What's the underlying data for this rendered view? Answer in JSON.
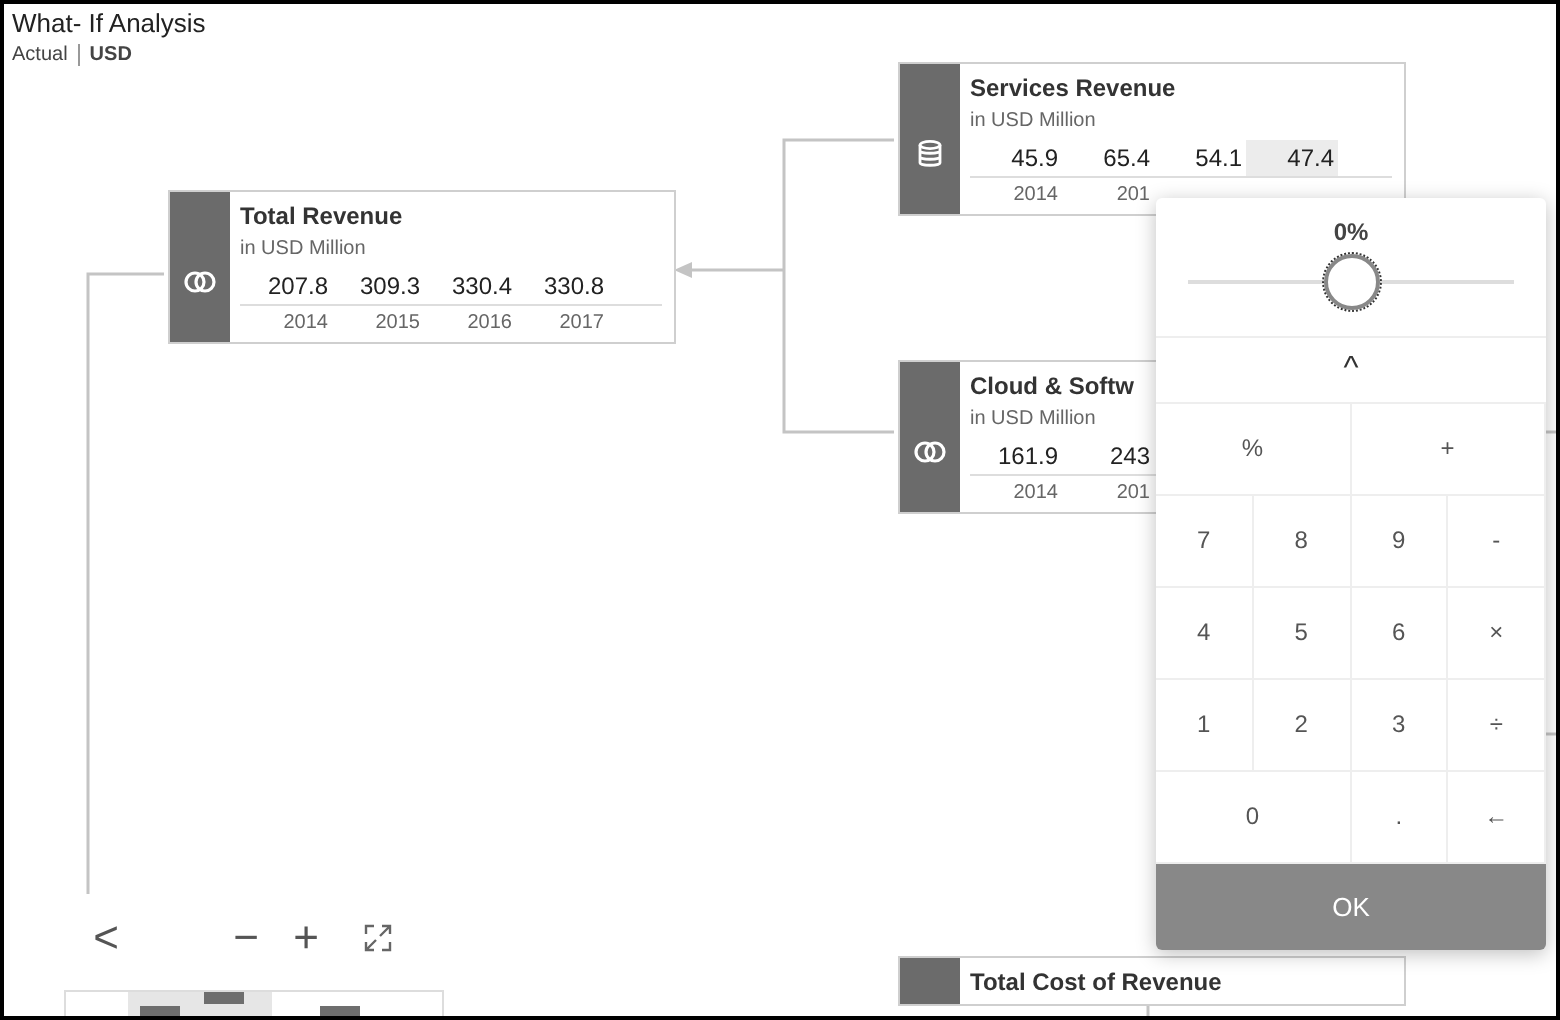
{
  "header": {
    "title": "What- If Analysis",
    "version": "Actual",
    "currency": "USD"
  },
  "nodes": [
    {
      "title": "Total Revenue",
      "unit": "in USD Million",
      "values": [
        {
          "text": "207.8",
          "selected": false
        },
        {
          "text": "309.3",
          "selected": false
        },
        {
          "text": "330.4",
          "selected": false
        },
        {
          "text": "330.8",
          "selected": false
        }
      ],
      "years": [
        "2014",
        "2015",
        "2016",
        "2017"
      ]
    },
    {
      "title": "Services Revenue",
      "unit": "in USD Million",
      "values": [
        {
          "text": "45.9",
          "selected": false
        },
        {
          "text": "65.4",
          "selected": false
        },
        {
          "text": "54.1",
          "selected": false
        },
        {
          "text": "47.4",
          "selected": true
        }
      ],
      "years": [
        "2014",
        "201"
      ]
    },
    {
      "title": "Cloud & Softw",
      "unit": "in USD Million",
      "values": [
        {
          "text": "161.9",
          "selected": false
        },
        {
          "text": "243",
          "selected": false
        }
      ],
      "years": [
        "2014",
        "201"
      ]
    },
    {
      "title": "Total Cost of Revenue"
    }
  ],
  "toolbar": {
    "back": "<",
    "zoom_out": "−",
    "zoom_in": "+"
  },
  "calculator": {
    "percent_reading": "0%",
    "slider": {
      "level": 0.5
    },
    "collapse": "^",
    "keys": [
      "%",
      "+",
      "7",
      "8",
      "9",
      "-",
      "4",
      "5",
      "6",
      "×",
      "1",
      "2",
      "3",
      "÷",
      "0",
      ".",
      "←"
    ],
    "ok": "OK"
  }
}
